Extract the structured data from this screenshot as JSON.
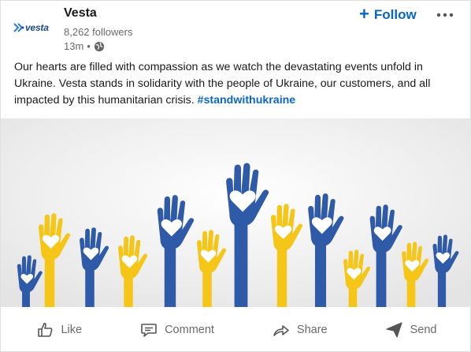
{
  "post": {
    "author": {
      "name": "Vesta",
      "followers": "8,262 followers",
      "time": "13m",
      "dot": "•",
      "logo_text": "vesta"
    },
    "follow_label": "Follow",
    "follow_plus": "+",
    "text_lines": "Our hearts are filled with compassion as we watch the devastating events unfold in Ukraine. Vesta stands in solidarity with the people of Ukraine, our customers, and all impacted by this humanitarian crisis. ",
    "hashtag": "#standwithukraine",
    "image": {
      "description_icon": "raised-hands-with-hearts",
      "colors": {
        "blue": "#2f5aa8",
        "yellow": "#f5c518",
        "background": "#ededed"
      }
    }
  },
  "actions": [
    {
      "label": "Like",
      "icon": "thumbs-up-icon"
    },
    {
      "label": "Comment",
      "icon": "comment-icon"
    },
    {
      "label": "Share",
      "icon": "share-arrow-icon"
    },
    {
      "label": "Send",
      "icon": "send-icon"
    }
  ],
  "colors": {
    "link_blue": "#0a66c2",
    "muted_text": "#666666"
  }
}
